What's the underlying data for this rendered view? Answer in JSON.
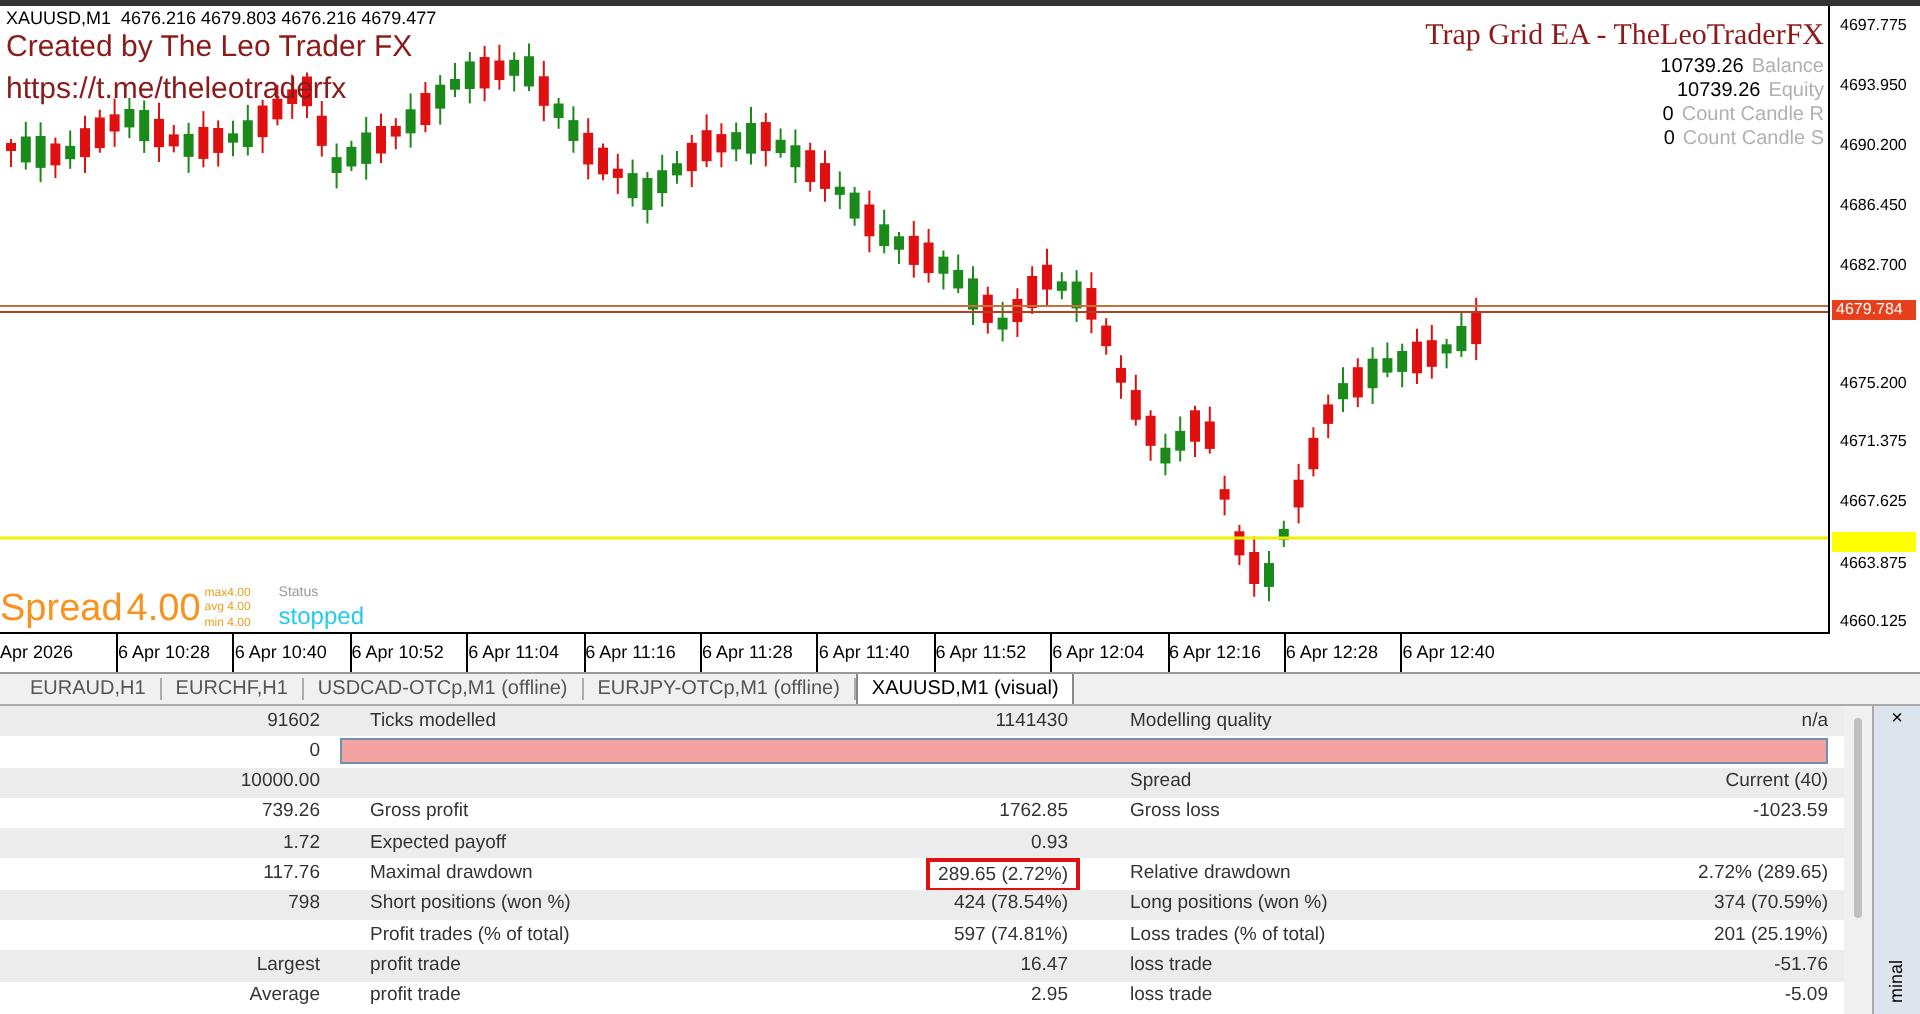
{
  "chart": {
    "symbol_line": "XAUUSD,M1  4676.216 4679.803 4676.216 4679.477",
    "credit": "Created by The Leo Trader FX",
    "link": "https://t.me/theleotraderfx",
    "ea_title": "Trap Grid EA - TheLeoTraderFX",
    "stat_values": [
      "10739.26",
      "10739.26",
      "0",
      "0"
    ],
    "stat_labels": [
      "Balance",
      "Equity",
      "Count Candle R",
      "Count Candle S"
    ],
    "spread": {
      "label": "Spread",
      "value": "4.00",
      "details": [
        "max4.00",
        "avg 4.00",
        "min 4.00"
      ]
    },
    "status": {
      "label": "Status",
      "value": "stopped"
    },
    "price_ticks": [
      "4697.775",
      "4693.950",
      "4690.200",
      "4686.450",
      "4682.700",
      "4675.200",
      "4671.375",
      "4667.625",
      "4663.875",
      "4660.125"
    ],
    "price_tags": [
      {
        "value": "4679.784",
        "color": "#e8401c"
      },
      {
        "color": "#ffff00"
      }
    ],
    "time_ticks": [
      "Apr 2026",
      "6 Apr 10:28",
      "6 Apr 10:40",
      "6 Apr 10:52",
      "6 Apr 11:04",
      "6 Apr 11:16",
      "6 Apr 11:28",
      "6 Apr 11:40",
      "6 Apr 11:52",
      "6 Apr 12:04",
      "6 Apr 12:16",
      "6 Apr 12:28",
      "6 Apr 12:40"
    ]
  },
  "tabs": [
    {
      "label": "EURAUD,H1",
      "selected": false
    },
    {
      "label": "EURCHF,H1",
      "selected": false
    },
    {
      "label": "USDCAD-OTCp,M1 (offline)",
      "selected": false
    },
    {
      "label": "EURJPY-OTCp,M1 (offline)",
      "selected": false
    },
    {
      "label": "XAUUSD,M1 (visual)",
      "selected": true
    }
  ],
  "report": {
    "rows": [
      {
        "kind": "text",
        "c1": "91602",
        "c2": "Ticks modelled",
        "c3": "1141430",
        "c4": "Modelling quality",
        "c5": "n/a"
      },
      {
        "kind": "bar",
        "c1": "0"
      },
      {
        "kind": "text",
        "c1": "10000.00",
        "c4": "Spread",
        "c5": "Current (40)"
      },
      {
        "kind": "text",
        "c1": "739.26",
        "c2": "Gross profit",
        "c3": "1762.85",
        "c4": "Gross loss",
        "c5": "-1023.59"
      },
      {
        "kind": "text",
        "c1": "1.72",
        "c2": "Expected payoff",
        "c3": "0.93"
      },
      {
        "kind": "text",
        "c1": "117.76",
        "c2": "Maximal drawdown",
        "c3": "289.65 (2.72%)",
        "c4": "Relative drawdown",
        "c5": "2.72% (289.65)",
        "boxed": true
      },
      {
        "kind": "text",
        "c1": "798",
        "c2": "Short positions (won %)",
        "c3": "424 (78.54%)",
        "c4": "Long positions (won %)",
        "c5": "374 (70.59%)"
      },
      {
        "kind": "text",
        "c2": "Profit trades (% of total)",
        "c3": "597 (74.81%)",
        "c4": "Loss trades (% of total)",
        "c5": "201 (25.19%)"
      },
      {
        "kind": "text",
        "c1": "Largest",
        "c2": "profit trade",
        "c3": "16.47",
        "c4": "loss trade",
        "c5": "-51.76"
      },
      {
        "kind": "text",
        "c1": "Average",
        "c2": "profit trade",
        "c3": "2.95",
        "c4": "loss trade",
        "c5": "-5.09"
      }
    ]
  },
  "side_panel": {
    "close": "×",
    "title": "minal"
  }
}
